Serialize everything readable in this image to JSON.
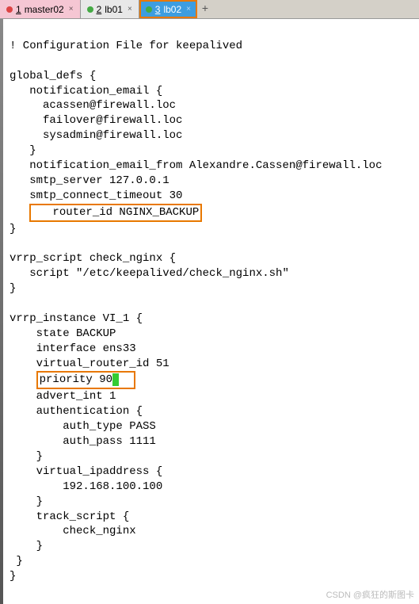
{
  "tabs": [
    {
      "num": "1",
      "label": "master02",
      "dot": "red"
    },
    {
      "num": "2",
      "label": "lb01",
      "dot": "green"
    },
    {
      "num": "3",
      "label": "lb02",
      "dot": "green"
    }
  ],
  "newtab_glyph": "+",
  "code": {
    "l01": "! Configuration File for keepalived",
    "l02": "",
    "l03": "global_defs {",
    "l04": "   notification_email {",
    "l05": "     acassen@firewall.loc",
    "l06": "     failover@firewall.loc",
    "l07": "     sysadmin@firewall.loc",
    "l08": "   }",
    "l09": "   notification_email_from Alexandre.Cassen@firewall.loc",
    "l10": "   smtp_server 127.0.0.1",
    "l11": "   smtp_connect_timeout 30",
    "l12": "   router_id NGINX_BACKUP",
    "l13": "}",
    "l14": "",
    "l15": "vrrp_script check_nginx {",
    "l16": "   script \"/etc/keepalived/check_nginx.sh\"",
    "l17": "}",
    "l18": "",
    "l19": "vrrp_instance VI_1 {",
    "l20": "    state BACKUP",
    "l21": "    interface ens33",
    "l22": "    virtual_router_id 51",
    "l23a": "    ",
    "l23b": "priority 90",
    "l24": "    advert_int 1",
    "l25": "    authentication {",
    "l26": "        auth_type PASS",
    "l27": "        auth_pass 1111",
    "l28": "    }",
    "l29": "    virtual_ipaddress {",
    "l30": "        192.168.100.100",
    "l31": "    }",
    "l32": "    track_script {",
    "l33": "        check_nginx",
    "l34": "    }",
    "l35": " }",
    "l36": "}"
  },
  "watermark": "CSDN @疯狂的斯图卡"
}
